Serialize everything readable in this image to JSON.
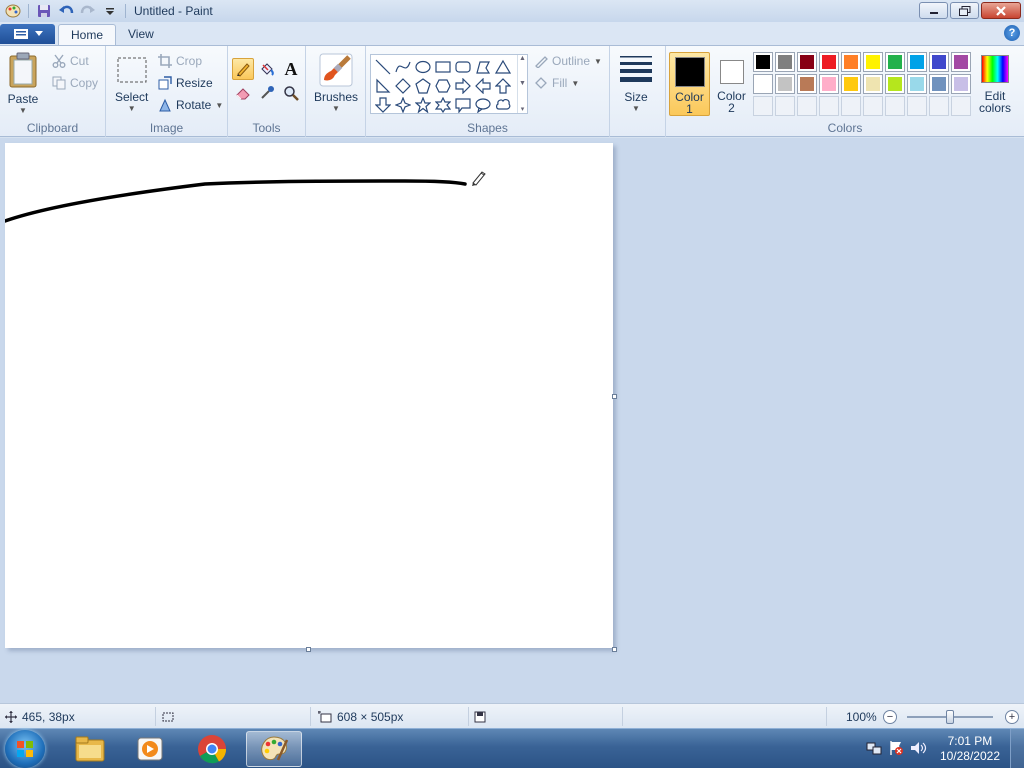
{
  "window": {
    "title": "Untitled - Paint"
  },
  "tabs": {
    "home": "Home",
    "view": "View"
  },
  "help": "?",
  "clipboard": {
    "label": "Clipboard",
    "paste": "Paste",
    "cut": "Cut",
    "copy": "Copy"
  },
  "image": {
    "label": "Image",
    "select": "Select",
    "crop": "Crop",
    "resize": "Resize",
    "rotate": "Rotate"
  },
  "tools": {
    "label": "Tools",
    "text_glyph": "A"
  },
  "brushes": {
    "label": "Brushes"
  },
  "shapes": {
    "label": "Shapes",
    "outline": "Outline",
    "fill": "Fill"
  },
  "size": {
    "label": "Size"
  },
  "colors": {
    "label": "Colors",
    "color1_line1": "Color",
    "color1_line2": "1",
    "color2_line1": "Color",
    "color2_line2": "2",
    "edit_line1": "Edit",
    "edit_line2": "colors",
    "color1": "#000000",
    "color2": "#ffffff",
    "palette_row1": [
      "#000000",
      "#7f7f7f",
      "#880015",
      "#ed1c24",
      "#ff7f27",
      "#fff200",
      "#22b14c",
      "#00a2e8",
      "#3f48cc",
      "#a349a4"
    ],
    "palette_row2": [
      "#ffffff",
      "#c3c3c3",
      "#b97a57",
      "#ffaec9",
      "#ffc90e",
      "#efe4b0",
      "#b5e61d",
      "#99d9ea",
      "#7092be",
      "#c8bfe7"
    ]
  },
  "status": {
    "cursor_pos": "465, 38px",
    "canvas_size": "608 × 505px",
    "zoom": "100%"
  },
  "taskbar": {
    "time": "7:01 PM",
    "date": "10/28/2022"
  }
}
